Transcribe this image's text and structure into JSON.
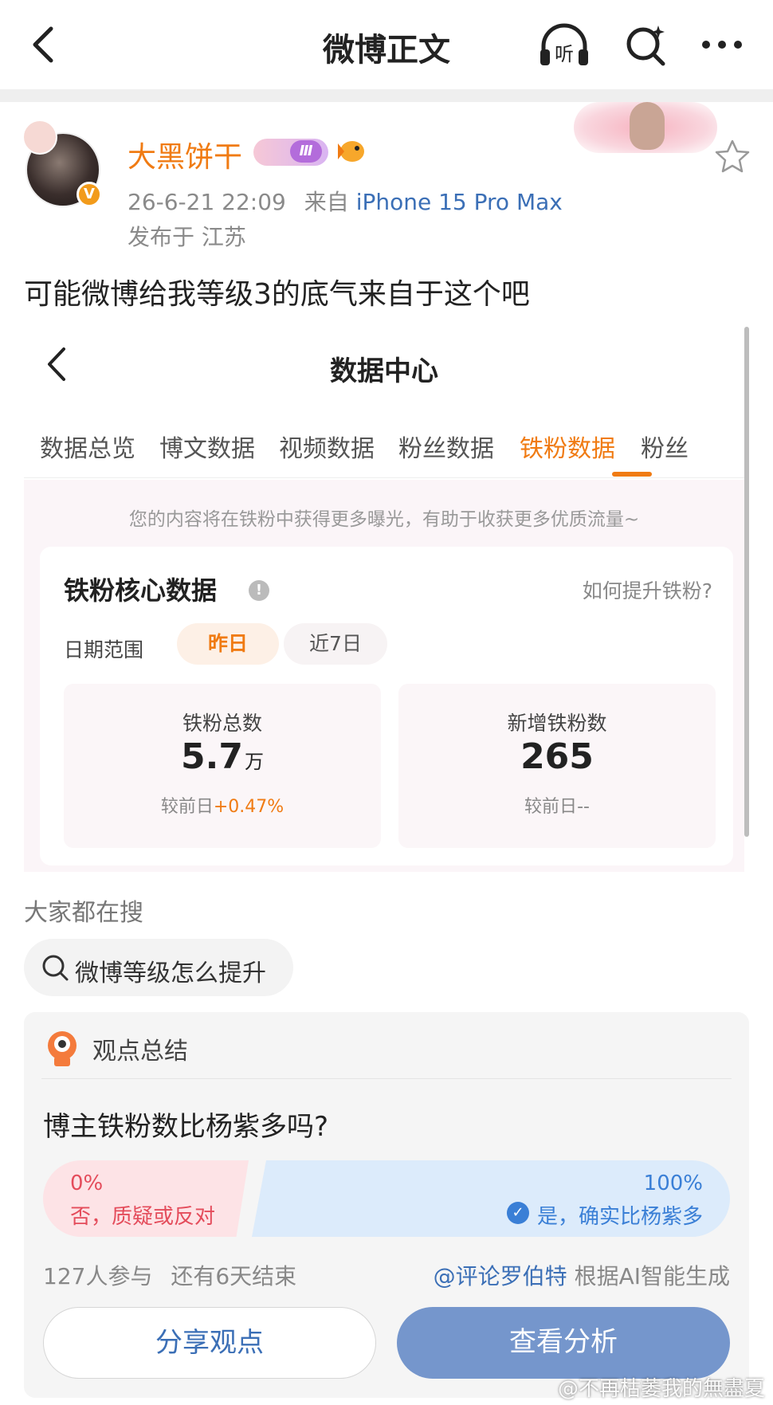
{
  "topbar": {
    "title": "微博正文",
    "listen_label": "听"
  },
  "post": {
    "username": "大黑饼干",
    "level_badge": "Ⅲ",
    "verified_mark": "V",
    "time": "26-6-21 22:09",
    "from_label": "来自",
    "device": "iPhone 15 Pro Max",
    "location": "发布于 江苏",
    "text": "可能微博给我等级3的底气来自于这个吧"
  },
  "embed": {
    "title": "数据中心",
    "tabs": [
      {
        "label": "数据总览"
      },
      {
        "label": "博文数据"
      },
      {
        "label": "视频数据"
      },
      {
        "label": "粉丝数据"
      },
      {
        "label": "铁粉数据"
      },
      {
        "label": "粉丝"
      }
    ],
    "active_tab": "铁粉数据",
    "notice": "您的内容将在铁粉中获得更多曝光，有助于收获更多优质流量~",
    "card": {
      "title": "铁粉核心数据",
      "info_mark": "!",
      "how_link": "如何提升铁粉?",
      "range_label": "日期范围",
      "chips": [
        {
          "label": "昨日"
        },
        {
          "label": "近7日"
        }
      ],
      "stats": [
        {
          "label": "铁粉总数",
          "value": "5.7",
          "unit": "万",
          "cmp_label": "较前日",
          "cmp_value": "+0.47%"
        },
        {
          "label": "新增铁粉数",
          "value": "265",
          "unit": "",
          "cmp_label": "较前日",
          "cmp_value": "--"
        }
      ]
    }
  },
  "hot_search": {
    "title": "大家都在搜",
    "query": "微博等级怎么提升"
  },
  "opinion": {
    "title": "观点总结",
    "question": "博主铁粉数比杨紫多吗?",
    "no": {
      "pct": "0%",
      "label": "否，质疑或反对",
      "fraction": 0.0
    },
    "yes": {
      "pct": "100%",
      "label": "是，确实比杨紫多",
      "fraction": 1.0
    },
    "participants": "127人参与",
    "remaining": "还有6天结束",
    "credit_user": "@评论罗伯特",
    "credit_text": "根据AI智能生成",
    "share_btn": "分享观点",
    "view_btn": "查看分析"
  },
  "watermark": "@不再枯萎我的無盡夏",
  "colors": {
    "accent_orange": "#f07b13",
    "link_blue": "#3b6fb6",
    "no_red": "#e44c5b",
    "yes_blue": "#3a7fd6",
    "button_blue": "#7596cc"
  }
}
